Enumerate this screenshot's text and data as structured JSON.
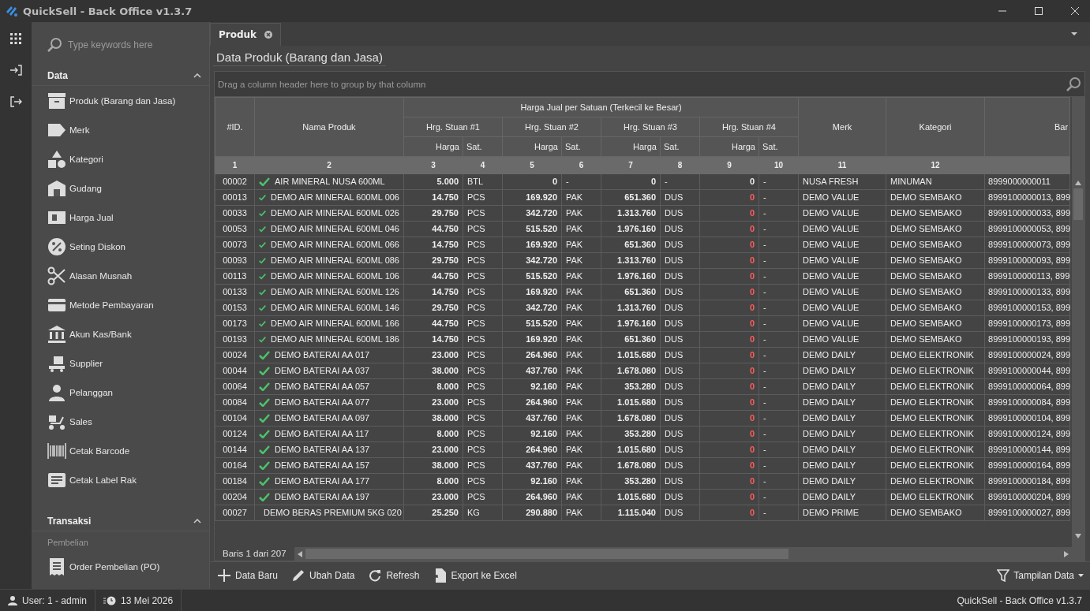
{
  "window": {
    "title": "QuickSell - Back Office v1.3.7"
  },
  "sidebar": {
    "search_placeholder": "Type keywords here",
    "sections": [
      {
        "title": "Data",
        "expanded": true,
        "groups": [
          {
            "items": [
              {
                "label": "Produk (Barang dan Jasa)"
              },
              {
                "label": "Merk"
              },
              {
                "label": "Kategori"
              },
              {
                "label": "Gudang"
              },
              {
                "label": "Harga Jual"
              },
              {
                "label": "Seting Diskon"
              },
              {
                "label": "Alasan Musnah"
              },
              {
                "label": "Metode Pembayaran"
              },
              {
                "label": "Akun Kas/Bank"
              },
              {
                "label": "Supplier"
              },
              {
                "label": "Pelanggan"
              },
              {
                "label": "Sales"
              },
              {
                "label": "Cetak Barcode"
              },
              {
                "label": "Cetak Label Rak"
              }
            ]
          }
        ]
      },
      {
        "title": "Transaksi",
        "expanded": true,
        "groups": [
          {
            "heading": "Pembelian",
            "items": [
              {
                "label": "Order Pembelian (PO)"
              }
            ]
          }
        ]
      }
    ]
  },
  "tabs": [
    {
      "label": "Produk",
      "selected": true
    }
  ],
  "page_title": "Data Produk (Barang dan Jasa)",
  "grid": {
    "group_hint": "Drag a column header here to group by that column",
    "band": "Harga Jual per Satuan (Terkecil ke Besar)",
    "unit_bands": [
      "Hrg. Stuan #1",
      "Hrg. Stuan #2",
      "Hrg. Stuan #3",
      "Hrg. Stuan #4"
    ],
    "columns": {
      "id": "#ID.",
      "name": "Nama Produk",
      "merk": "Merk",
      "kategori": "Kategori",
      "barcode": "Bar"
    },
    "unit_columns": [
      {
        "harga": "Harga",
        "sat": "Sat."
      },
      {
        "harga": "Harga",
        "sat": "Sat."
      },
      {
        "harga": "Harga",
        "sat": "Sat."
      },
      {
        "harga": "Harga",
        "sat": "Sat."
      }
    ],
    "column_numbers": [
      "1",
      "2",
      "3",
      "4",
      "5",
      "6",
      "7",
      "8",
      "9",
      "10",
      "11",
      "12"
    ],
    "rows": [
      {
        "id": "00002",
        "name": "AIR MINERAL NUSA 600ML",
        "prices": [
          {
            "harga": "5.000",
            "sat": "BTL",
            "alert": false
          },
          {
            "harga": "0",
            "sat": "-",
            "alert": false
          },
          {
            "harga": "0",
            "sat": "-",
            "alert": false
          },
          {
            "harga": "0",
            "sat": "-",
            "alert": false
          }
        ],
        "merk": "NUSA FRESH",
        "kategori": "MINUMAN",
        "barcode": "8999000000011"
      },
      {
        "id": "00013",
        "name": "DEMO AIR MINERAL 600ML 006",
        "prices": [
          {
            "harga": "14.750",
            "sat": "PCS",
            "alert": false
          },
          {
            "harga": "169.920",
            "sat": "PAK",
            "alert": false
          },
          {
            "harga": "651.360",
            "sat": "DUS",
            "alert": false
          },
          {
            "harga": "0",
            "sat": "-",
            "alert": true
          }
        ],
        "merk": "DEMO VALUE",
        "kategori": "DEMO SEMBAKO",
        "barcode": "8999100000013, 899"
      },
      {
        "id": "00033",
        "name": "DEMO AIR MINERAL 600ML 026",
        "prices": [
          {
            "harga": "29.750",
            "sat": "PCS",
            "alert": false
          },
          {
            "harga": "342.720",
            "sat": "PAK",
            "alert": false
          },
          {
            "harga": "1.313.760",
            "sat": "DUS",
            "alert": false
          },
          {
            "harga": "0",
            "sat": "-",
            "alert": true
          }
        ],
        "merk": "DEMO VALUE",
        "kategori": "DEMO SEMBAKO",
        "barcode": "8999100000033, 899"
      },
      {
        "id": "00053",
        "name": "DEMO AIR MINERAL 600ML 046",
        "prices": [
          {
            "harga": "44.750",
            "sat": "PCS",
            "alert": false
          },
          {
            "harga": "515.520",
            "sat": "PAK",
            "alert": false
          },
          {
            "harga": "1.976.160",
            "sat": "DUS",
            "alert": false
          },
          {
            "harga": "0",
            "sat": "-",
            "alert": true
          }
        ],
        "merk": "DEMO VALUE",
        "kategori": "DEMO SEMBAKO",
        "barcode": "8999100000053, 899"
      },
      {
        "id": "00073",
        "name": "DEMO AIR MINERAL 600ML 066",
        "prices": [
          {
            "harga": "14.750",
            "sat": "PCS",
            "alert": false
          },
          {
            "harga": "169.920",
            "sat": "PAK",
            "alert": false
          },
          {
            "harga": "651.360",
            "sat": "DUS",
            "alert": false
          },
          {
            "harga": "0",
            "sat": "-",
            "alert": true
          }
        ],
        "merk": "DEMO VALUE",
        "kategori": "DEMO SEMBAKO",
        "barcode": "8999100000073, 899"
      },
      {
        "id": "00093",
        "name": "DEMO AIR MINERAL 600ML 086",
        "prices": [
          {
            "harga": "29.750",
            "sat": "PCS",
            "alert": false
          },
          {
            "harga": "342.720",
            "sat": "PAK",
            "alert": false
          },
          {
            "harga": "1.313.760",
            "sat": "DUS",
            "alert": false
          },
          {
            "harga": "0",
            "sat": "-",
            "alert": true
          }
        ],
        "merk": "DEMO VALUE",
        "kategori": "DEMO SEMBAKO",
        "barcode": "8999100000093, 899"
      },
      {
        "id": "00113",
        "name": "DEMO AIR MINERAL 600ML 106",
        "prices": [
          {
            "harga": "44.750",
            "sat": "PCS",
            "alert": false
          },
          {
            "harga": "515.520",
            "sat": "PAK",
            "alert": false
          },
          {
            "harga": "1.976.160",
            "sat": "DUS",
            "alert": false
          },
          {
            "harga": "0",
            "sat": "-",
            "alert": true
          }
        ],
        "merk": "DEMO VALUE",
        "kategori": "DEMO SEMBAKO",
        "barcode": "8999100000113, 899"
      },
      {
        "id": "00133",
        "name": "DEMO AIR MINERAL 600ML 126",
        "prices": [
          {
            "harga": "14.750",
            "sat": "PCS",
            "alert": false
          },
          {
            "harga": "169.920",
            "sat": "PAK",
            "alert": false
          },
          {
            "harga": "651.360",
            "sat": "DUS",
            "alert": false
          },
          {
            "harga": "0",
            "sat": "-",
            "alert": true
          }
        ],
        "merk": "DEMO VALUE",
        "kategori": "DEMO SEMBAKO",
        "barcode": "8999100000133, 899"
      },
      {
        "id": "00153",
        "name": "DEMO AIR MINERAL 600ML 146",
        "prices": [
          {
            "harga": "29.750",
            "sat": "PCS",
            "alert": false
          },
          {
            "harga": "342.720",
            "sat": "PAK",
            "alert": false
          },
          {
            "harga": "1.313.760",
            "sat": "DUS",
            "alert": false
          },
          {
            "harga": "0",
            "sat": "-",
            "alert": true
          }
        ],
        "merk": "DEMO VALUE",
        "kategori": "DEMO SEMBAKO",
        "barcode": "8999100000153, 899"
      },
      {
        "id": "00173",
        "name": "DEMO AIR MINERAL 600ML 166",
        "prices": [
          {
            "harga": "44.750",
            "sat": "PCS",
            "alert": false
          },
          {
            "harga": "515.520",
            "sat": "PAK",
            "alert": false
          },
          {
            "harga": "1.976.160",
            "sat": "DUS",
            "alert": false
          },
          {
            "harga": "0",
            "sat": "-",
            "alert": true
          }
        ],
        "merk": "DEMO VALUE",
        "kategori": "DEMO SEMBAKO",
        "barcode": "8999100000173, 899"
      },
      {
        "id": "00193",
        "name": "DEMO AIR MINERAL 600ML 186",
        "prices": [
          {
            "harga": "14.750",
            "sat": "PCS",
            "alert": false
          },
          {
            "harga": "169.920",
            "sat": "PAK",
            "alert": false
          },
          {
            "harga": "651.360",
            "sat": "DUS",
            "alert": false
          },
          {
            "harga": "0",
            "sat": "-",
            "alert": true
          }
        ],
        "merk": "DEMO VALUE",
        "kategori": "DEMO SEMBAKO",
        "barcode": "8999100000193, 899"
      },
      {
        "id": "00024",
        "name": "DEMO BATERAI AA 017",
        "prices": [
          {
            "harga": "23.000",
            "sat": "PCS",
            "alert": false
          },
          {
            "harga": "264.960",
            "sat": "PAK",
            "alert": false
          },
          {
            "harga": "1.015.680",
            "sat": "DUS",
            "alert": false
          },
          {
            "harga": "0",
            "sat": "-",
            "alert": true
          }
        ],
        "merk": "DEMO DAILY",
        "kategori": "DEMO ELEKTRONIK",
        "barcode": "8999100000024, 899"
      },
      {
        "id": "00044",
        "name": "DEMO BATERAI AA 037",
        "prices": [
          {
            "harga": "38.000",
            "sat": "PCS",
            "alert": false
          },
          {
            "harga": "437.760",
            "sat": "PAK",
            "alert": false
          },
          {
            "harga": "1.678.080",
            "sat": "DUS",
            "alert": false
          },
          {
            "harga": "0",
            "sat": "-",
            "alert": true
          }
        ],
        "merk": "DEMO DAILY",
        "kategori": "DEMO ELEKTRONIK",
        "barcode": "8999100000044, 899"
      },
      {
        "id": "00064",
        "name": "DEMO BATERAI AA 057",
        "prices": [
          {
            "harga": "8.000",
            "sat": "PCS",
            "alert": false
          },
          {
            "harga": "92.160",
            "sat": "PAK",
            "alert": false
          },
          {
            "harga": "353.280",
            "sat": "DUS",
            "alert": false
          },
          {
            "harga": "0",
            "sat": "-",
            "alert": true
          }
        ],
        "merk": "DEMO DAILY",
        "kategori": "DEMO ELEKTRONIK",
        "barcode": "8999100000064, 899"
      },
      {
        "id": "00084",
        "name": "DEMO BATERAI AA 077",
        "prices": [
          {
            "harga": "23.000",
            "sat": "PCS",
            "alert": false
          },
          {
            "harga": "264.960",
            "sat": "PAK",
            "alert": false
          },
          {
            "harga": "1.015.680",
            "sat": "DUS",
            "alert": false
          },
          {
            "harga": "0",
            "sat": "-",
            "alert": true
          }
        ],
        "merk": "DEMO DAILY",
        "kategori": "DEMO ELEKTRONIK",
        "barcode": "8999100000084, 899"
      },
      {
        "id": "00104",
        "name": "DEMO BATERAI AA 097",
        "prices": [
          {
            "harga": "38.000",
            "sat": "PCS",
            "alert": false
          },
          {
            "harga": "437.760",
            "sat": "PAK",
            "alert": false
          },
          {
            "harga": "1.678.080",
            "sat": "DUS",
            "alert": false
          },
          {
            "harga": "0",
            "sat": "-",
            "alert": true
          }
        ],
        "merk": "DEMO DAILY",
        "kategori": "DEMO ELEKTRONIK",
        "barcode": "8999100000104, 899"
      },
      {
        "id": "00124",
        "name": "DEMO BATERAI AA 117",
        "prices": [
          {
            "harga": "8.000",
            "sat": "PCS",
            "alert": false
          },
          {
            "harga": "92.160",
            "sat": "PAK",
            "alert": false
          },
          {
            "harga": "353.280",
            "sat": "DUS",
            "alert": false
          },
          {
            "harga": "0",
            "sat": "-",
            "alert": true
          }
        ],
        "merk": "DEMO DAILY",
        "kategori": "DEMO ELEKTRONIK",
        "barcode": "8999100000124, 899"
      },
      {
        "id": "00144",
        "name": "DEMO BATERAI AA 137",
        "prices": [
          {
            "harga": "23.000",
            "sat": "PCS",
            "alert": false
          },
          {
            "harga": "264.960",
            "sat": "PAK",
            "alert": false
          },
          {
            "harga": "1.015.680",
            "sat": "DUS",
            "alert": false
          },
          {
            "harga": "0",
            "sat": "-",
            "alert": true
          }
        ],
        "merk": "DEMO DAILY",
        "kategori": "DEMO ELEKTRONIK",
        "barcode": "8999100000144, 899"
      },
      {
        "id": "00164",
        "name": "DEMO BATERAI AA 157",
        "prices": [
          {
            "harga": "38.000",
            "sat": "PCS",
            "alert": false
          },
          {
            "harga": "437.760",
            "sat": "PAK",
            "alert": false
          },
          {
            "harga": "1.678.080",
            "sat": "DUS",
            "alert": false
          },
          {
            "harga": "0",
            "sat": "-",
            "alert": true
          }
        ],
        "merk": "DEMO DAILY",
        "kategori": "DEMO ELEKTRONIK",
        "barcode": "8999100000164, 899"
      },
      {
        "id": "00184",
        "name": "DEMO BATERAI AA 177",
        "prices": [
          {
            "harga": "8.000",
            "sat": "PCS",
            "alert": false
          },
          {
            "harga": "92.160",
            "sat": "PAK",
            "alert": false
          },
          {
            "harga": "353.280",
            "sat": "DUS",
            "alert": false
          },
          {
            "harga": "0",
            "sat": "-",
            "alert": true
          }
        ],
        "merk": "DEMO DAILY",
        "kategori": "DEMO ELEKTRONIK",
        "barcode": "8999100000184, 899"
      },
      {
        "id": "00204",
        "name": "DEMO BATERAI AA 197",
        "prices": [
          {
            "harga": "23.000",
            "sat": "PCS",
            "alert": false
          },
          {
            "harga": "264.960",
            "sat": "PAK",
            "alert": false
          },
          {
            "harga": "1.015.680",
            "sat": "DUS",
            "alert": false
          },
          {
            "harga": "0",
            "sat": "-",
            "alert": true
          }
        ],
        "merk": "DEMO DAILY",
        "kategori": "DEMO ELEKTRONIK",
        "barcode": "8999100000204, 899"
      },
      {
        "id": "00027",
        "name": "DEMO BERAS PREMIUM 5KG 020",
        "prices": [
          {
            "harga": "25.250",
            "sat": "KG",
            "alert": false
          },
          {
            "harga": "290.880",
            "sat": "PAK",
            "alert": false
          },
          {
            "harga": "1.115.040",
            "sat": "DUS",
            "alert": false
          },
          {
            "harga": "0",
            "sat": "-",
            "alert": true
          }
        ],
        "merk": "DEMO PRIME",
        "kategori": "DEMO SEMBAKO",
        "barcode": "8999100000027, 899"
      }
    ],
    "row_counter": "Baris 1 dari 207"
  },
  "toolbar": {
    "buttons": [
      {
        "kind": "add",
        "label": "Data Baru"
      },
      {
        "kind": "edit",
        "label": "Ubah Data"
      },
      {
        "kind": "refresh",
        "label": "Refresh"
      },
      {
        "kind": "export",
        "label": "Export ke Excel"
      }
    ],
    "view_menu": "Tampilan Data"
  },
  "status_bar": {
    "user": "User: 1 - admin",
    "date": "13 Mei 2026",
    "app": "QuickSell - Back Office v1.3.7"
  }
}
